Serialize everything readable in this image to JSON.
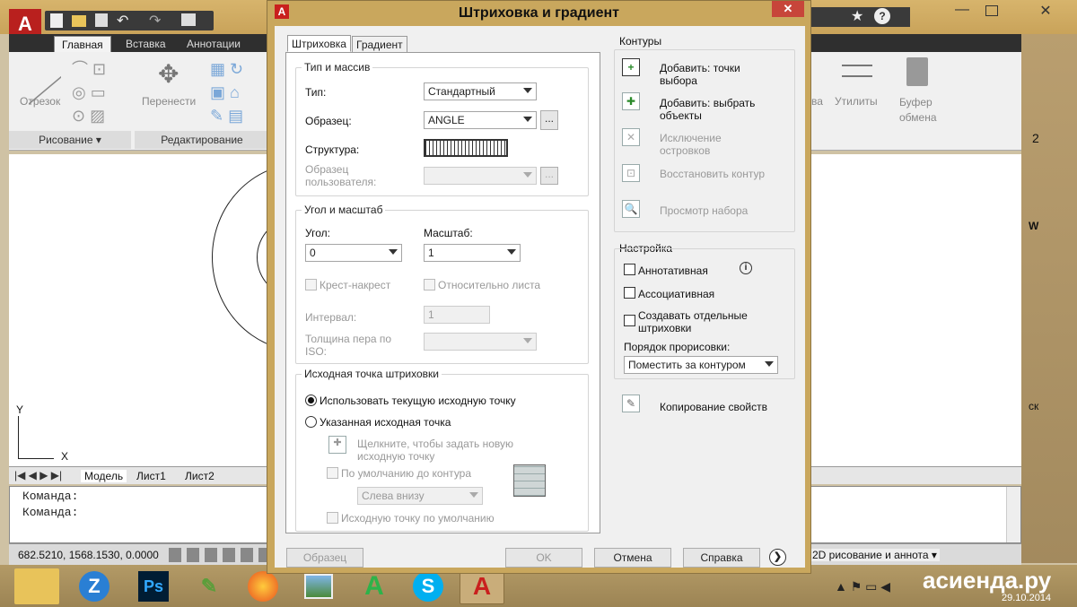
{
  "background": {
    "ribbon_tabs": [
      "Главная",
      "Вставка",
      "Аннотации"
    ],
    "tools": {
      "line": "Отрезок",
      "move": "Перенести",
      "utilities": "Утилиты",
      "clipboard": "Буфер обмена",
      "partial_right": "ва"
    },
    "panels": {
      "draw": "Рисование",
      "modify": "Редактирование"
    },
    "layout_tabs": [
      "Модель",
      "Лист1",
      "Лист2"
    ],
    "command_lines": [
      "Команда:",
      "Команда:"
    ],
    "coordinates": "682.5210, 1568.1530, 0.0000",
    "workspace": "2D рисование и аннота",
    "ucs_y": "Y",
    "ucs_x": "X",
    "right_digit": "2",
    "right_w": "W",
    "right_k": "ск"
  },
  "taskbar": {
    "watermark": "асиенда.ру",
    "date": "29.10.2014",
    "apps": [
      "explorer",
      "zoho",
      "photoshop",
      "notepad",
      "firefox",
      "photos",
      "autocad-green",
      "skype",
      "autocad-red"
    ]
  },
  "dialog": {
    "title": "Штриховка и градиент",
    "close": "✕",
    "tabs": [
      "Штриховка",
      "Градиент"
    ],
    "type_group": {
      "title": "Тип и массив",
      "type_label": "Тип:",
      "type_value": "Стандартный",
      "pattern_label": "Образец:",
      "pattern_value": "ANGLE",
      "browse": "...",
      "swatch_label": "Структура:",
      "custom_label": "Образец пользователя:"
    },
    "angle_group": {
      "title": "Угол и масштаб",
      "angle_label": "Угол:",
      "angle_value": "0",
      "scale_label": "Масштаб:",
      "scale_value": "1",
      "double_label": "Крест-накрест",
      "relative_label": "Относительно листа",
      "spacing_label": "Интервал:",
      "spacing_value": "1",
      "iso_label": "Толщина пера по ISO:"
    },
    "origin_group": {
      "title": "Исходная точка штриховки",
      "use_current": "Использовать текущую исходную точку",
      "specified": "Указанная исходная точка",
      "click_to_set": "Щелкните, чтобы задать новую исходную точку",
      "default_boundary": "По умолчанию до контура",
      "position_value": "Слева внизу",
      "store_default": "Исходную точку по умолчанию"
    },
    "boundaries": {
      "title": "Контуры",
      "add_pick": "Добавить: точки выбора",
      "add_select": "Добавить: выбрать объекты",
      "remove_islands": "Исключение островков",
      "recreate": "Восстановить контур",
      "view": "Просмотр набора"
    },
    "options": {
      "title": "Настройка",
      "annotative": "Аннотативная",
      "associative": "Ассоциативная",
      "separate": "Создавать отдельные штриховки",
      "draw_order_label": "Порядок прорисовки:",
      "draw_order_value": "Поместить за контуром"
    },
    "inherit": "Копирование свойств",
    "buttons": {
      "preview": "Образец",
      "ok": "OK",
      "cancel": "Отмена",
      "help": "Справка"
    }
  }
}
